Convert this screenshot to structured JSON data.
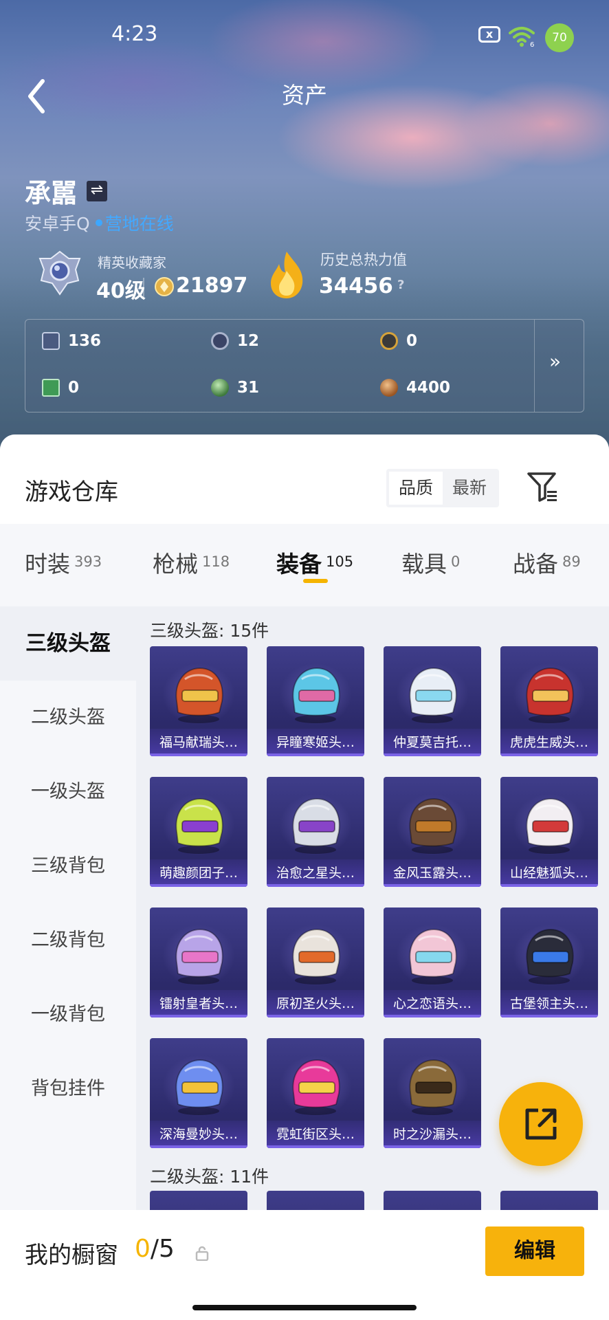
{
  "status_bar": {
    "time": "4:23",
    "close_box": "x",
    "battery": "70",
    "signal": "6"
  },
  "header": {
    "title": "资产"
  },
  "profile": {
    "name": "承嚚",
    "switch_glyph": "⇌",
    "platform": "安卓手Q",
    "online_status": "营地在线",
    "rank_title": "精英收藏家",
    "level": "40级",
    "coins": "21897",
    "heat_title": "历史总热力值",
    "heat_value": "34456",
    "help_glyph": "?"
  },
  "stats": [
    {
      "icon": "card-icon",
      "value": "136",
      "color": "#5a6a8a"
    },
    {
      "icon": "coin-silver-icon",
      "value": "12",
      "color": "#8a95aa"
    },
    {
      "icon": "coin-gold-icon",
      "value": "0",
      "color": "#c7962b"
    },
    {
      "icon": "green-ticket-icon",
      "value": "0",
      "color": "#3f9a55"
    },
    {
      "icon": "green-orb-icon",
      "value": "31",
      "color": "#4c8a4a"
    },
    {
      "icon": "bronze-coin-icon",
      "value": "4400",
      "color": "#b06a2e"
    }
  ],
  "stats_more": "»",
  "warehouse": {
    "title": "游戏仓库",
    "sort_options": [
      "品质",
      "最新"
    ]
  },
  "tabs": [
    {
      "label": "时装",
      "count": "393"
    },
    {
      "label": "枪械",
      "count": "118"
    },
    {
      "label": "装备",
      "count": "105"
    },
    {
      "label": "载具",
      "count": "0"
    },
    {
      "label": "战备",
      "count": "89"
    }
  ],
  "side_menu": [
    "三级头盔",
    "二级头盔",
    "一级头盔",
    "三级背包",
    "二级背包",
    "一级背包",
    "背包挂件"
  ],
  "sections": [
    {
      "title": "三级头盔: 15件"
    },
    {
      "title": "二级头盔: 11件"
    }
  ],
  "items": [
    {
      "name": "福马献瑞头…",
      "color": "#d4552a",
      "accent": "#f0c34a"
    },
    {
      "name": "异瞳寒姬头…",
      "color": "#5cc6e6",
      "accent": "#e06aa6"
    },
    {
      "name": "仲夏莫吉托…",
      "color": "#e8eef6",
      "accent": "#8ad8f0"
    },
    {
      "name": "虎虎生威头…",
      "color": "#c8332e",
      "accent": "#f3c25a"
    },
    {
      "name": "萌趣颜团子…",
      "color": "#c9e24a",
      "accent": "#8a3fd0"
    },
    {
      "name": "治愈之星头…",
      "color": "#d9dde6",
      "accent": "#8844c8"
    },
    {
      "name": "金风玉露头…",
      "color": "#6a4a36",
      "accent": "#c07a2a"
    },
    {
      "name": "山经魅狐头…",
      "color": "#f2eef2",
      "accent": "#d33a3a"
    },
    {
      "name": "镭射皇者头…",
      "color": "#b8a4e8",
      "accent": "#e876c8"
    },
    {
      "name": "原初圣火头…",
      "color": "#e9e3dc",
      "accent": "#e26a2a"
    },
    {
      "name": "心之恋语头…",
      "color": "#f2c6d6",
      "accent": "#86d8ee"
    },
    {
      "name": "古堡领主头…",
      "color": "#2a2c3a",
      "accent": "#3a7ae8"
    },
    {
      "name": "深海曼妙头…",
      "color": "#6e8ef0",
      "accent": "#f3c23a"
    },
    {
      "name": "霓虹街区头…",
      "color": "#e83a9a",
      "accent": "#f5d34a"
    },
    {
      "name": "时之沙漏头…",
      "color": "#8a6a3a",
      "accent": "#3a2a1a"
    }
  ],
  "showcase": {
    "label": "我的橱窗",
    "used": "0",
    "total": "/5",
    "edit_label": "编辑"
  }
}
